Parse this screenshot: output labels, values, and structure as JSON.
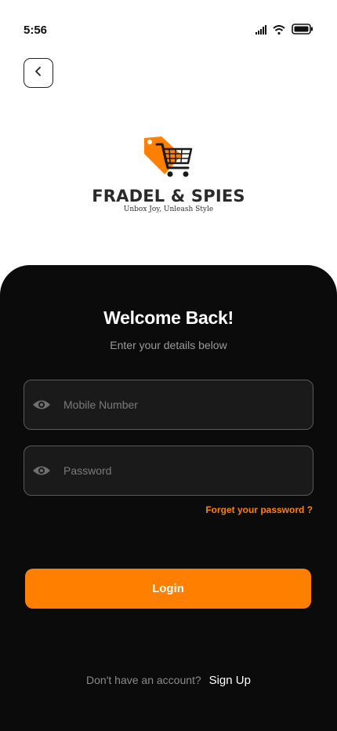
{
  "status_bar": {
    "time": "5:56",
    "icons": [
      "signal-icon",
      "wifi-icon",
      "battery-icon"
    ]
  },
  "header": {
    "back_icon": "chevron-left-icon"
  },
  "brand": {
    "name": "FRADEL & SPIES",
    "tagline": "Unbox Joy, Unleash Style",
    "logo_icon": "shopping-cart-tag-icon",
    "accent": "#ff7f00"
  },
  "form": {
    "title": "Welcome Back!",
    "subtitle": "Enter your details below",
    "mobile": {
      "placeholder": "Mobile Number",
      "value": "",
      "icon": "eye-icon"
    },
    "password": {
      "placeholder": "Password",
      "value": "",
      "icon": "eye-icon"
    },
    "forgot_label": "Forget your password ?",
    "login_label": "Login"
  },
  "footer": {
    "question": "Don't have an account?",
    "signup_label": "Sign Up"
  },
  "colors": {
    "panel": "#0b0b0b",
    "accent": "#ff7f00",
    "field_bg": "#1a1a1a"
  }
}
